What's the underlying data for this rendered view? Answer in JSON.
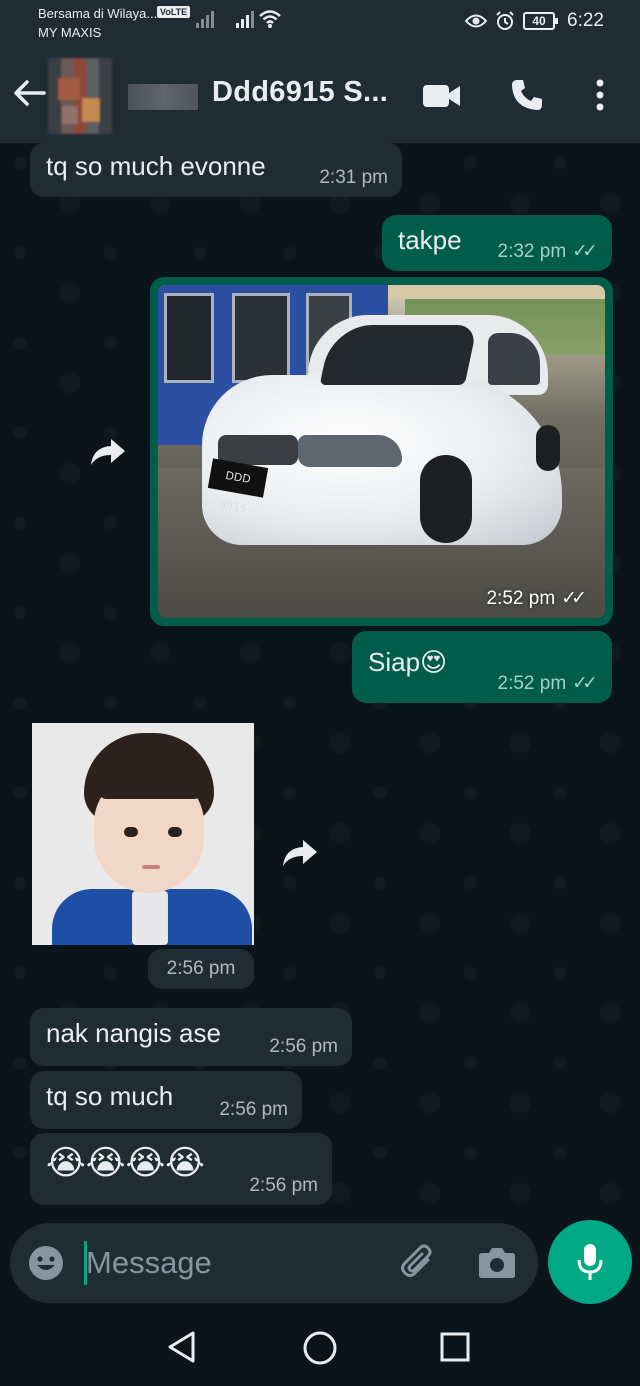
{
  "status_bar": {
    "carrier_line1": "Bersama di Wilaya...",
    "carrier_line2": "MY MAXIS",
    "volte": "VoLTE",
    "battery": "40",
    "time": "6:22"
  },
  "header": {
    "contact_name": "Ddd6915 S..."
  },
  "messages": [
    {
      "direction": "in",
      "text": "tq so much evonne",
      "time": "2:31 pm"
    },
    {
      "direction": "out",
      "text": "takpe",
      "time": "2:32 pm",
      "read": true
    },
    {
      "direction": "out",
      "type": "image",
      "plate": "DDD 6915",
      "time": "2:52 pm",
      "read": true
    },
    {
      "direction": "out",
      "text": "Siap😍",
      "time": "2:52 pm",
      "read": true
    },
    {
      "direction": "in",
      "type": "sticker",
      "time": "2:56 pm"
    },
    {
      "direction": "in",
      "text": "nak nangis ase",
      "time": "2:56 pm"
    },
    {
      "direction": "in",
      "text": "tq so much",
      "time": "2:56 pm"
    },
    {
      "direction": "in",
      "text": "😭😭😭😭",
      "time": "2:56 pm"
    }
  ],
  "input": {
    "placeholder": "Message"
  },
  "colors": {
    "background": "#0b141a",
    "header": "#1f2c34",
    "incoming_bubble": "#202c33",
    "outgoing_bubble": "#005c4b",
    "accent": "#00a884"
  },
  "icons": [
    "back-arrow-icon",
    "video-call-icon",
    "voice-call-icon",
    "more-options-icon",
    "forward-icon",
    "emoji-icon",
    "attach-icon",
    "camera-icon",
    "mic-icon",
    "nav-back-icon",
    "nav-home-icon",
    "nav-recent-icon"
  ]
}
